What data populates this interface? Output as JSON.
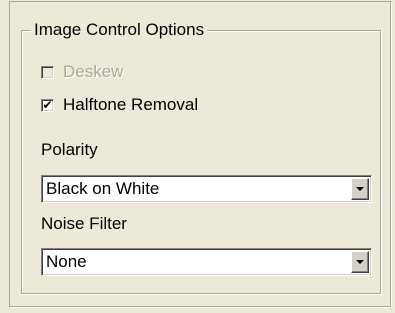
{
  "group": {
    "title": "Image Control Options"
  },
  "options": {
    "deskew": {
      "label": "Deskew",
      "checked": false,
      "disabled": true
    },
    "halftone_removal": {
      "label": "Halftone Removal",
      "checked": true,
      "disabled": false
    }
  },
  "polarity": {
    "label": "Polarity",
    "selected": "Black on White"
  },
  "noise_filter": {
    "label": "Noise Filter",
    "selected": "None"
  },
  "colors": {
    "face": "#ece9d8",
    "border": "#aca899",
    "disabled_text": "#aca899"
  },
  "icons": {
    "checkmark": "check-icon",
    "dropdown": "chevron-down-icon"
  }
}
